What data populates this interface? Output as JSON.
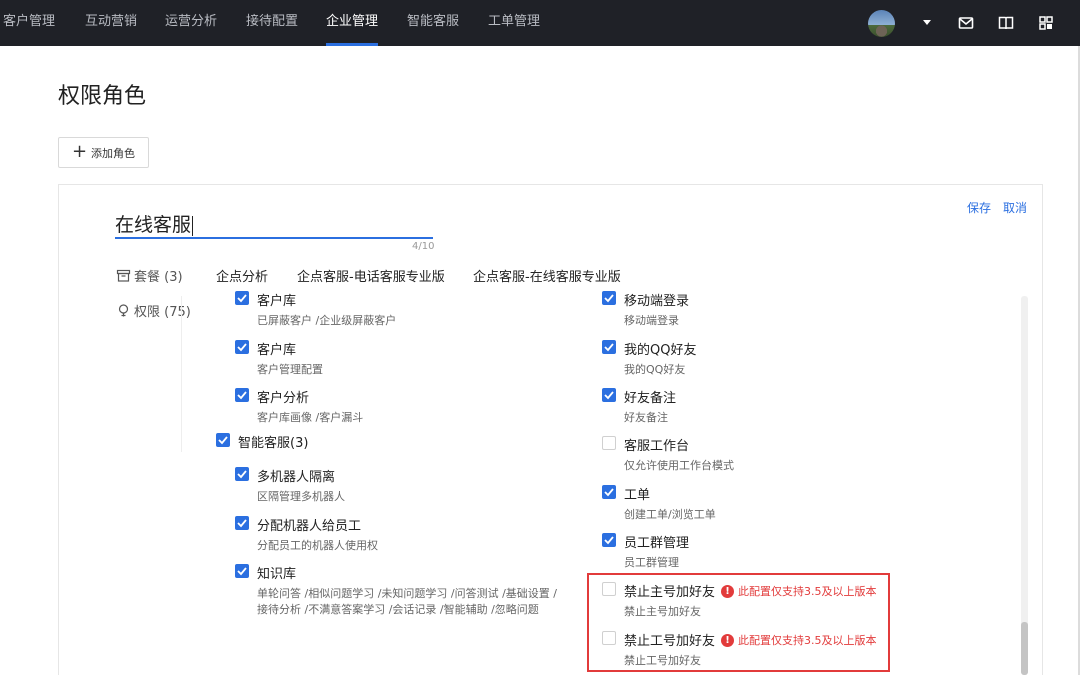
{
  "nav": {
    "items": [
      {
        "label": "客户管理",
        "active": false
      },
      {
        "label": "互动营销",
        "active": false
      },
      {
        "label": "运营分析",
        "active": false
      },
      {
        "label": "接待配置",
        "active": false
      },
      {
        "label": "企业管理",
        "active": true
      },
      {
        "label": "智能客服",
        "active": false
      },
      {
        "label": "工单管理",
        "active": false
      }
    ],
    "icons": [
      "avatar",
      "chevron-down-icon",
      "mail-icon",
      "book-icon",
      "apps-grid-icon"
    ]
  },
  "page": {
    "title": "权限角色",
    "add_role_label": "添加角色"
  },
  "editor": {
    "save_label": "保存",
    "cancel_label": "取消",
    "role_name": "在线客服",
    "char_counter": "4/10"
  },
  "sidebar": {
    "package_label": "套餐 (3)",
    "permission_label": "权限 (75)"
  },
  "packages": [
    "企点分析",
    "企点客服-电话客服专业版",
    "企点客服-在线客服专业版"
  ],
  "permissions_left": [
    {
      "label": "客户库",
      "desc": "已屏蔽客户 /企业级屏蔽客户",
      "checked": true
    },
    {
      "label": "客户库",
      "desc": "客户管理配置",
      "checked": true
    },
    {
      "label": "客户分析",
      "desc": "客户库画像 /客户漏斗",
      "checked": true
    },
    {
      "label": "智能客服(3)",
      "desc": "",
      "checked": true
    },
    {
      "label": "多机器人隔离",
      "desc": "区隔管理多机器人",
      "checked": true
    },
    {
      "label": "分配机器人给员工",
      "desc": "分配员工的机器人使用权",
      "checked": true
    },
    {
      "label": "知识库",
      "desc": "单轮问答 /相似问题学习 /未知问题学习 /问答测试 /基础设置 /",
      "desc2": "接待分析 /不满意答案学习 /会话记录 /智能辅助 /忽略问题",
      "checked": true
    }
  ],
  "permissions_right": [
    {
      "label": "移动端登录",
      "desc": "移动端登录",
      "checked": true
    },
    {
      "label": "我的QQ好友",
      "desc": "我的QQ好友",
      "checked": true
    },
    {
      "label": "好友备注",
      "desc": "好友备注",
      "checked": true
    },
    {
      "label": "客服工作台",
      "desc": "仅允许使用工作台模式",
      "checked": false
    },
    {
      "label": "工单",
      "desc": "创建工单/浏览工单",
      "checked": true
    },
    {
      "label": "员工群管理",
      "desc": "员工群管理",
      "checked": true
    },
    {
      "label": "禁止主号加好友",
      "desc": "禁止主号加好友",
      "checked": false,
      "warning": "此配置仅支持3.5及以上版本"
    },
    {
      "label": "禁止工号加好友",
      "desc": "禁止工号加好友",
      "checked": false,
      "warning": "此配置仅支持3.5及以上版本"
    }
  ],
  "colors": {
    "accent": "#2b6fe0",
    "warning": "#e23b3b",
    "nav_bg": "#1f2127"
  }
}
